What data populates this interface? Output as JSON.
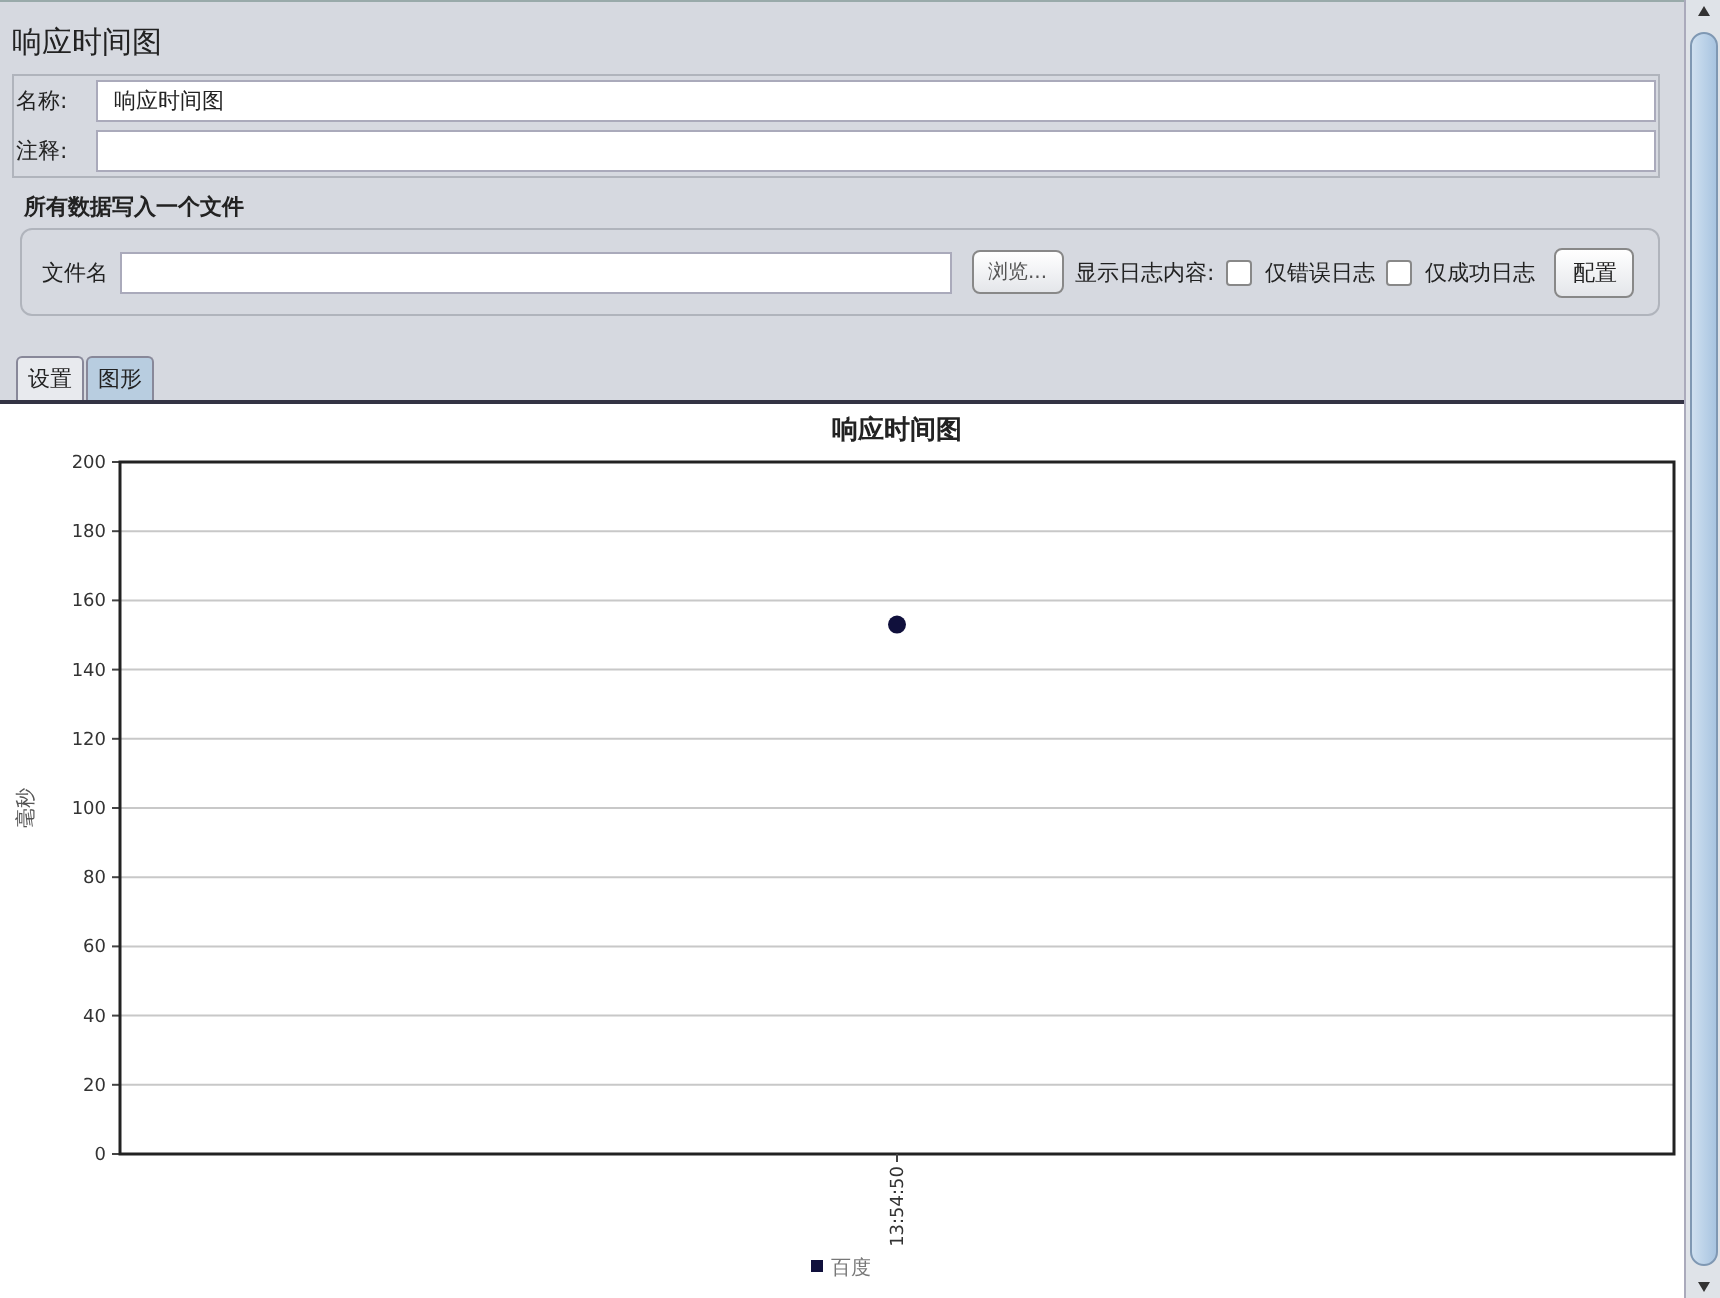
{
  "panel": {
    "title": "响应时间图"
  },
  "fields": [
    {
      "label": "名称:",
      "value": "响应时间图"
    },
    {
      "label": "注释:"
    }
  ],
  "file_section": {
    "heading": "所有数据写入一个文件",
    "file_label": "文件名",
    "browse_button": "浏览...",
    "log_label": "显示日志内容:",
    "checkboxes": [
      {
        "label": "仅错误日志",
        "checked": false
      },
      {
        "label": "仅成功日志",
        "checked": false
      }
    ],
    "config_button": "配置"
  },
  "tabs": [
    {
      "label": "设置",
      "selected": false
    },
    {
      "label": "图形",
      "selected": true
    }
  ],
  "chart": {
    "chart_data": {
      "type": "scatter",
      "grid": true,
      "title": "响应时间图",
      "ylabel": "毫秒",
      "categories": [
        "13:54:50"
      ],
      "ylim": [
        0,
        200
      ],
      "yticks": [
        0,
        20,
        40,
        60,
        80,
        100,
        120,
        140,
        160,
        180,
        200
      ],
      "series": [
        {
          "name": "百度",
          "color": "#10103c",
          "values": [
            153
          ]
        }
      ]
    }
  }
}
